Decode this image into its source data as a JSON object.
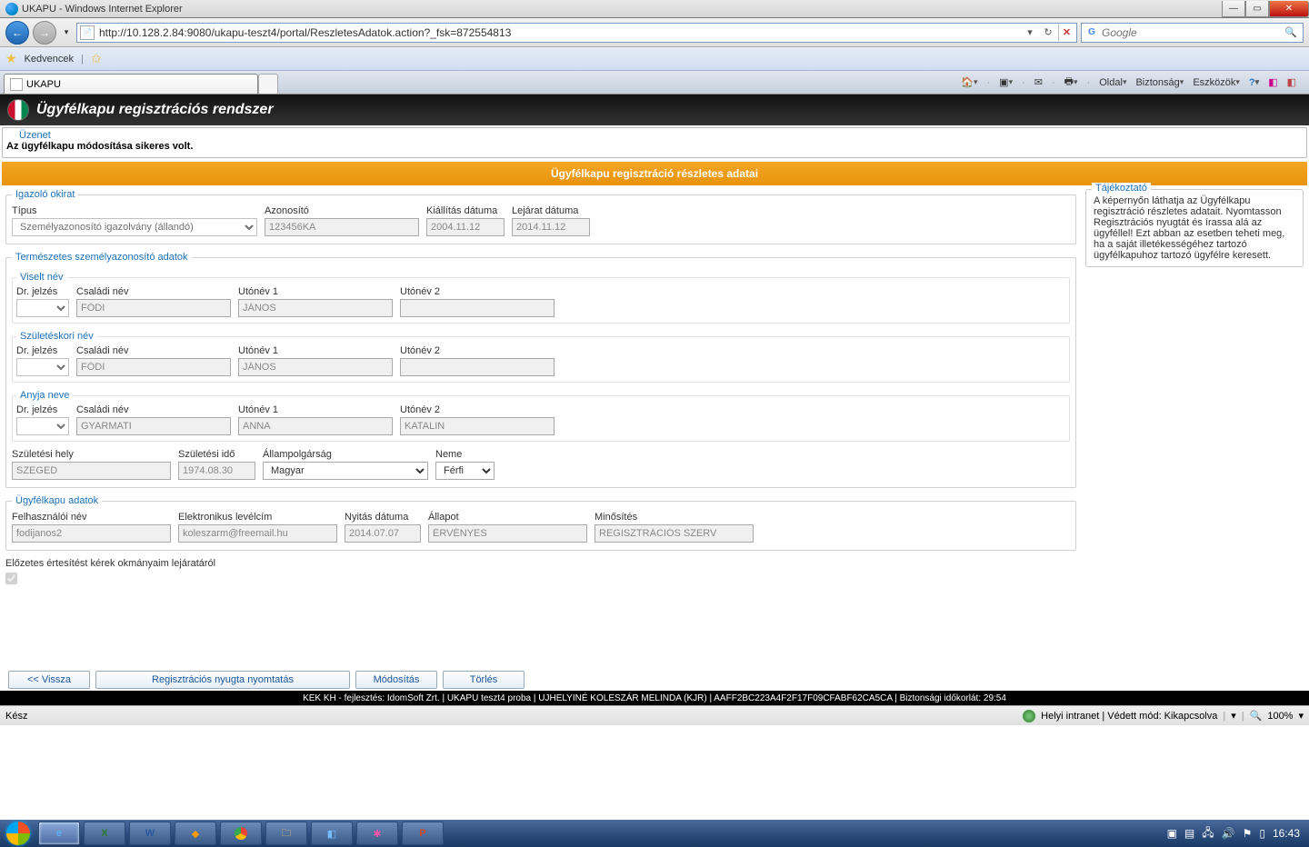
{
  "window": {
    "title": "UKAPU - Windows Internet Explorer"
  },
  "address": {
    "url": "http://10.128.2.84:9080/ukapu-teszt4/portal/ReszletesAdatok.action?_fsk=872554813",
    "search_placeholder": "Google"
  },
  "favorites": {
    "label": "Kedvencek"
  },
  "tab": {
    "title": "UKAPU"
  },
  "commandbar": {
    "page": "Oldal",
    "security": "Biztonság",
    "tools": "Eszközök"
  },
  "app": {
    "title": "Ügyfélkapu regisztrációs rendszer",
    "msg_title": "Üzenet",
    "msg_text": "Az ügyfélkapu módosítása sikeres volt.",
    "section_title": "Ügyfélkapu regisztráció részletes adatai"
  },
  "help": {
    "legend": "Tájékoztató",
    "text": "A képernyőn láthatja az Ügyfélkapu regisztráció részletes adatait. Nyomtasson Regisztrációs nyugtát és írassa alá az ügyféllel! Ezt abban az esetben teheti meg, ha a saját illetékességéhez tartozó ügyfélkapuhoz tartozó ügyfélre keresett."
  },
  "okirat": {
    "legend": "Igazoló okirat",
    "tipus_label": "Típus",
    "tipus_value": "Személyazonosító igazolvány (állandó)",
    "azon_label": "Azonosító",
    "azon_value": "123456KA",
    "kiall_label": "Kiállítás dátuma",
    "kiall_value": "2004.11.12",
    "lejar_label": "Lejárat dátuma",
    "lejar_value": "2014.11.12"
  },
  "szemely": {
    "legend": "Természetes személyazonosító adatok",
    "viselt_legend": "Viselt név",
    "szuletes_legend": "Születéskori név",
    "anyja_legend": "Anyja neve",
    "dr_label": "Dr. jelzés",
    "csalad_label": "Családi név",
    "uto1_label": "Utónév 1",
    "uto2_label": "Utónév 2",
    "viselt": {
      "csalad": "FŐDI",
      "uto1": "JÁNOS",
      "uto2": ""
    },
    "szulet": {
      "csalad": "FŐDI",
      "uto1": "JÁNOS",
      "uto2": ""
    },
    "anyja": {
      "csalad": "GYARMATI",
      "uto1": "ANNA",
      "uto2": "KATALIN"
    },
    "hely_label": "Születési hely",
    "hely_value": "SZEGED",
    "ido_label": "Születési idő",
    "ido_value": "1974.08.30",
    "allam_label": "Állampolgárság",
    "allam_value": "Magyar",
    "nem_label": "Neme",
    "nem_value": "Férfi"
  },
  "ukapu": {
    "legend": "Ügyfélkapu adatok",
    "user_label": "Felhasználói név",
    "user_value": "fodijanos2",
    "email_label": "Elektronikus levélcím",
    "email_value": "koleszarm@freemail.hu",
    "open_label": "Nyitás dátuma",
    "open_value": "2014.07.07",
    "status_label": "Állapot",
    "status_value": "ÉRVÉNYES",
    "minos_label": "Minősítés",
    "minos_value": "REGISZTRÁCIÓS SZERV"
  },
  "notify": {
    "label": "Előzetes értesítést kérek okmányaim lejáratáról"
  },
  "buttons": {
    "back": "<< Vissza",
    "receipt": "Regisztrációs nyugta nyomtatás",
    "modify": "Módosítás",
    "delete": "Törlés"
  },
  "footer": {
    "text": "KEK KH - fejlesztés: IdomSoft Zrt.  |  UKAPU teszt4 proba  |  UJHELYINÉ KOLESZÁR MELINDA  (KJR)  |  AAFF2BC223A4F2F17F09CFABF62CA5CA  |  Biztonsági időkorlát:   29:54"
  },
  "status": {
    "ready": "Kész",
    "zone": "Helyi intranet | Védett mód: Kikapcsolva",
    "zoom": "100%"
  },
  "clock": "16:43"
}
